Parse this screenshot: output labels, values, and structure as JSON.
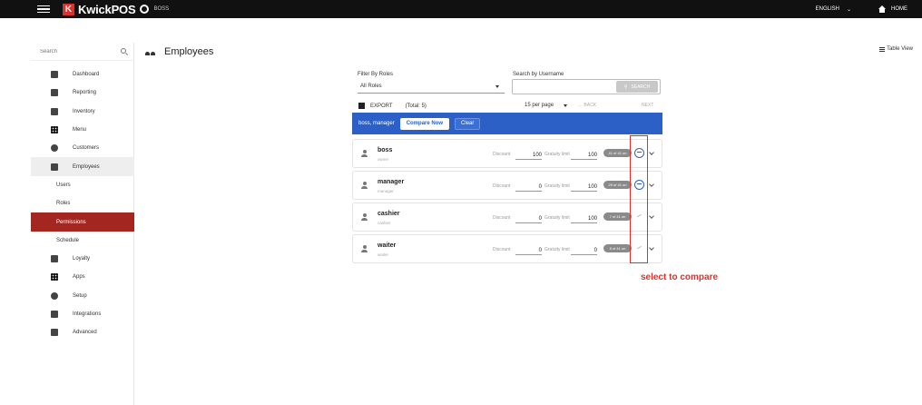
{
  "topbar": {
    "brand": "KwickPOS",
    "user": "BOSS",
    "language": "ENGLISH",
    "home": "HOME"
  },
  "sidebar": {
    "search_placeholder": "Search",
    "items": [
      {
        "label": "Dashboard",
        "icon": "dashboard-icon"
      },
      {
        "label": "Reporting",
        "icon": "reporting-icon"
      },
      {
        "label": "Inventory",
        "icon": "inventory-icon"
      },
      {
        "label": "Menu",
        "icon": "menu-icon"
      },
      {
        "label": "Customers",
        "icon": "customers-icon"
      },
      {
        "label": "Employees",
        "icon": "employees-icon"
      },
      {
        "label": "Users"
      },
      {
        "label": "Roles"
      },
      {
        "label": "Permissions"
      },
      {
        "label": "Schedule"
      },
      {
        "label": "Loyalty",
        "icon": "loyalty-icon"
      },
      {
        "label": "Apps",
        "icon": "apps-icon"
      },
      {
        "label": "Setup",
        "icon": "setup-icon"
      },
      {
        "label": "Integrations",
        "icon": "integrations-icon"
      },
      {
        "label": "Advanced",
        "icon": "advanced-icon"
      }
    ]
  },
  "page": {
    "title": "Employees",
    "table_view": "Table View"
  },
  "filters": {
    "role_label": "Filter By Roles",
    "role_value": "All Roles",
    "username_label": "Search by Username",
    "search_button": "SEARCH"
  },
  "list": {
    "export": "EXPORT",
    "total": "(Total: 5)",
    "per_page": "15 per page",
    "back": "BACK",
    "next": "NEXT"
  },
  "compare": {
    "selected": "boss, manager",
    "compare_now": "Compare Now",
    "clear": "Clear"
  },
  "labels": {
    "discount": "Discount",
    "gratuity": "Gratuity limit"
  },
  "employees": [
    {
      "name": "boss",
      "role": "owner",
      "discount": "100",
      "gratuity": "100",
      "badge": "41 of 41 on"
    },
    {
      "name": "manager",
      "role": "manager",
      "discount": "0",
      "gratuity": "100",
      "badge": "29 of 41 on"
    },
    {
      "name": "cashier",
      "role": "cashier",
      "discount": "0",
      "gratuity": "100",
      "badge": "7 of 41 on"
    },
    {
      "name": "waiter",
      "role": "waiter",
      "discount": "0",
      "gratuity": "0",
      "badge": "8 of 41 on"
    }
  ],
  "annotation": "select to compare",
  "colors": {
    "accent": "#2d60c6",
    "brand": "#d9322c",
    "selected_nav": "#a32620"
  }
}
